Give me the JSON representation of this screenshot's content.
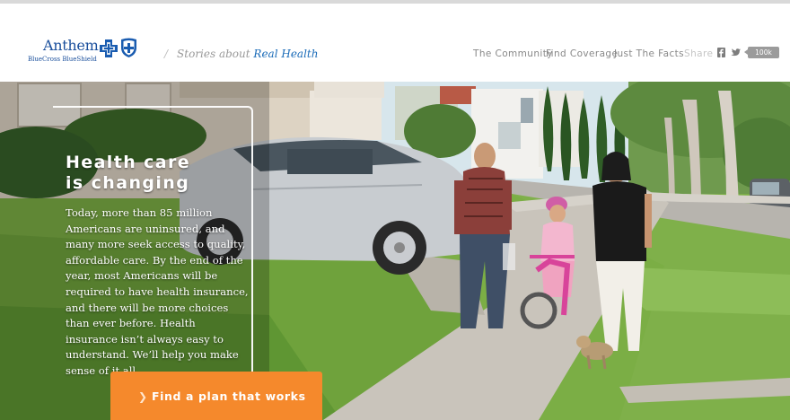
{
  "brand": {
    "name": "Anthem.",
    "sub": "BlueCross BlueShield",
    "tagline_prefix": "Stories about",
    "tagline_highlight": "Real Health"
  },
  "nav": {
    "community": "The Community",
    "coverage": "Find Coverage",
    "facts": "Just The Facts",
    "share": "Share",
    "share_count": "100k"
  },
  "hero": {
    "headline_line1": "Health care",
    "headline_line2": "is changing",
    "body": "Today, more than 85 million Americans are uninsured, and many more seek access to quality, affordable care. By the end of the year, most Americans will be required to have health insurance, and there will be more choices than ever before. Health insurance isn’t always easy to understand. We’ll help you make sense of it all.",
    "cta_label": "Find a plan that works"
  },
  "icons": {
    "logo_cross": "blue-cross-icon",
    "logo_shield": "blue-shield-icon",
    "facebook": "facebook-icon",
    "twitter": "twitter-icon",
    "cta": "chevron-right-icon"
  },
  "colors": {
    "brand_blue": "#1a4f9c",
    "accent_blue": "#1a6bb8",
    "cta_orange": "#f5892c",
    "nav_gray": "#888888"
  }
}
